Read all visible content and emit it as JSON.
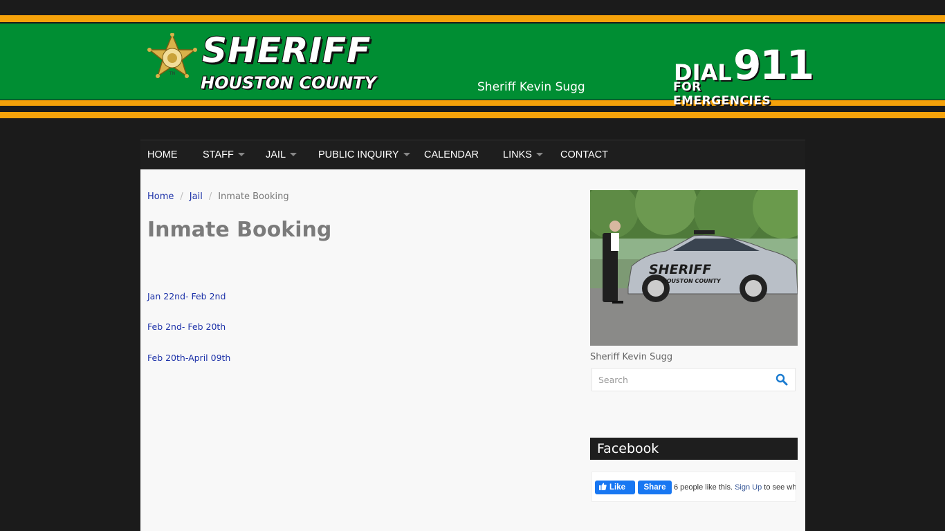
{
  "header": {
    "logo_word": "SHERIFF",
    "logo_sub": "HOUSTON COUNTY",
    "badge_text": "TN",
    "sheriff_name": "Sheriff Kevin Sugg",
    "dial_word": "DIAL",
    "dial_number": "911",
    "dial_sub": "FOR EMERGENCIES"
  },
  "nav": {
    "items": [
      {
        "label": "HOME",
        "dropdown": false
      },
      {
        "label": "STAFF",
        "dropdown": true
      },
      {
        "label": "JAIL",
        "dropdown": true
      },
      {
        "label": "PUBLIC INQUIRY",
        "dropdown": true
      },
      {
        "label": "CALENDAR",
        "dropdown": false
      },
      {
        "label": "LINKS",
        "dropdown": true
      },
      {
        "label": "CONTACT",
        "dropdown": false
      }
    ]
  },
  "breadcrumb": {
    "home": "Home",
    "sep": "/",
    "jail": "Jail",
    "current": "Inmate Booking"
  },
  "main": {
    "title": "Inmate Booking",
    "links": [
      "Jan 22nd- Feb 2nd",
      "Feb 2nd- Feb 20th",
      "Feb 20th-April 09th"
    ]
  },
  "sidebar": {
    "photo_caption": "Sheriff Kevin Sugg",
    "car_text": "SHERIFF",
    "car_subtext": "HOUSTON COUNTY",
    "search_placeholder": "Search",
    "facebook_heading": "Facebook",
    "fb_like": "Like",
    "fb_share": "Share",
    "fb_count_text": "6 people like this.",
    "fb_signup": "Sign Up",
    "fb_tail": "to see wha"
  },
  "colors": {
    "stripe": "#f5a20a",
    "header_green": "#008e33",
    "nav_bg": "#1e1e1e",
    "link": "#1c31a8",
    "facebook_blue": "#1877f2"
  }
}
